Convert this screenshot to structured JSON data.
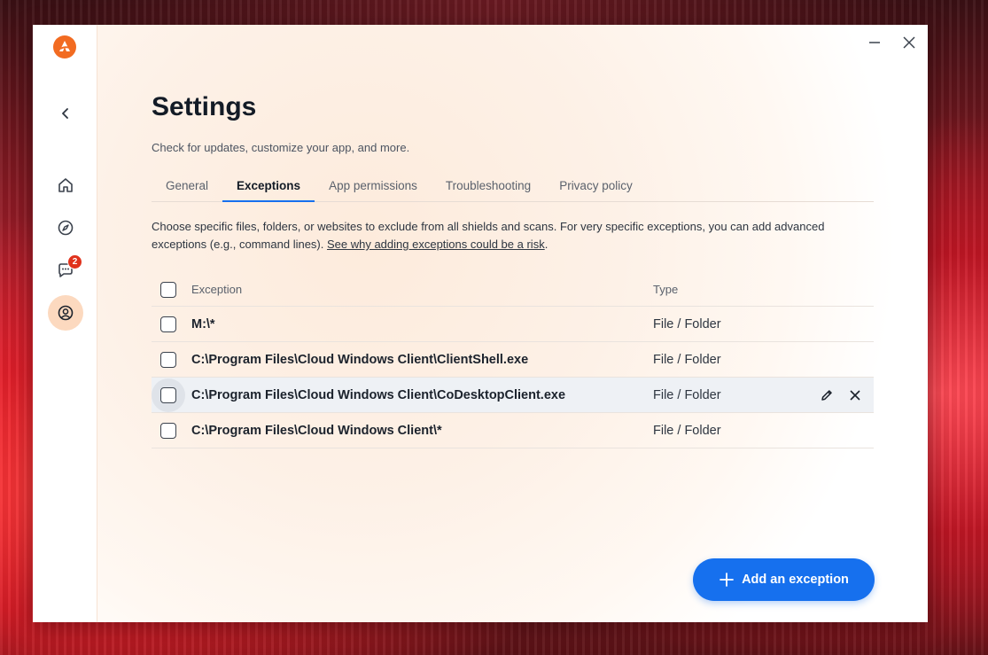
{
  "colors": {
    "accent": "#1670ee",
    "brand": "#f26b21",
    "badge": "#e0321c",
    "active_nav": "#fcd9bf"
  },
  "window": {
    "minimize_icon": "minimize-icon",
    "close_icon": "close-icon"
  },
  "sidebar": {
    "back_icon": "chevron-left-icon",
    "items": [
      {
        "name": "home",
        "icon": "home-icon"
      },
      {
        "name": "explore",
        "icon": "compass-icon"
      },
      {
        "name": "messages",
        "icon": "chat-icon",
        "badge": "2"
      },
      {
        "name": "account",
        "icon": "user-circle-icon",
        "active": true
      }
    ]
  },
  "header": {
    "title": "Settings",
    "subtitle": "Check for updates, customize your app, and more."
  },
  "tabs": [
    {
      "label": "General"
    },
    {
      "label": "Exceptions",
      "active": true
    },
    {
      "label": "App permissions"
    },
    {
      "label": "Troubleshooting"
    },
    {
      "label": "Privacy policy"
    }
  ],
  "description": {
    "text": "Choose specific files, folders, or websites to exclude from all shields and scans. For very specific exceptions, you can add advanced exceptions (e.g., command lines). ",
    "link": "See why adding exceptions could be a risk",
    "suffix": "."
  },
  "table": {
    "columns": {
      "exception": "Exception",
      "type": "Type"
    },
    "rows": [
      {
        "exception": "M:\\*",
        "type": "File / Folder"
      },
      {
        "exception": "C:\\Program Files\\Cloud Windows Client\\ClientShell.exe",
        "type": "File / Folder"
      },
      {
        "exception": "C:\\Program Files\\Cloud Windows Client\\CoDesktopClient.exe",
        "type": "File / Folder"
      },
      {
        "exception": "C:\\Program Files\\Cloud Windows Client\\*",
        "type": "File / Folder"
      }
    ]
  },
  "add_button": {
    "label": "Add an exception"
  }
}
